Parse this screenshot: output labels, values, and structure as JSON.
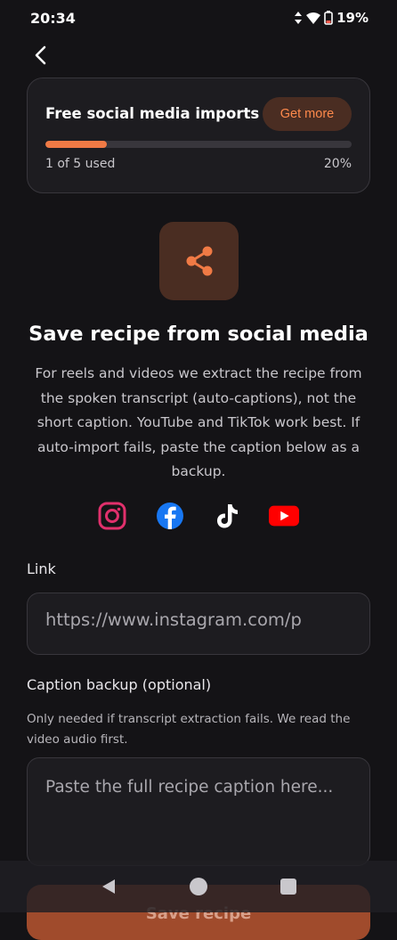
{
  "status_bar": {
    "time": "20:34",
    "battery": "19%",
    "icons": [
      "data-arrows-icon",
      "wifi-icon",
      "battery-icon"
    ]
  },
  "quota": {
    "title": "Free social media imports",
    "get_more_label": "Get more",
    "used_text": "1 of 5 used",
    "percent_text": "20%",
    "progress_fraction": 0.2
  },
  "main": {
    "heading": "Save recipe from social media",
    "description": "For reels and videos we extract the recipe from the spoken transcript (auto-captions), not the short caption. YouTube and TikTok work best. If auto-import fails, paste the caption below as a backup.",
    "platforms": [
      "instagram-icon",
      "facebook-icon",
      "tiktok-icon",
      "youtube-icon"
    ]
  },
  "link_field": {
    "label": "Link",
    "value": "https://www.instagram.com/p"
  },
  "caption_field": {
    "label": "Caption backup (optional)",
    "helper": "Only needed if transcript extraction fails. We read the video audio first.",
    "placeholder": "Paste the full recipe caption here..."
  },
  "save_button": {
    "label": "Save recipe"
  },
  "colors": {
    "background": "#141316",
    "card": "#1d1c20",
    "accent": "#f07a45",
    "accent_bg": "#4a2d22",
    "instagram": "#e1306c",
    "facebook": "#1877f2",
    "youtube": "#ff0000"
  }
}
